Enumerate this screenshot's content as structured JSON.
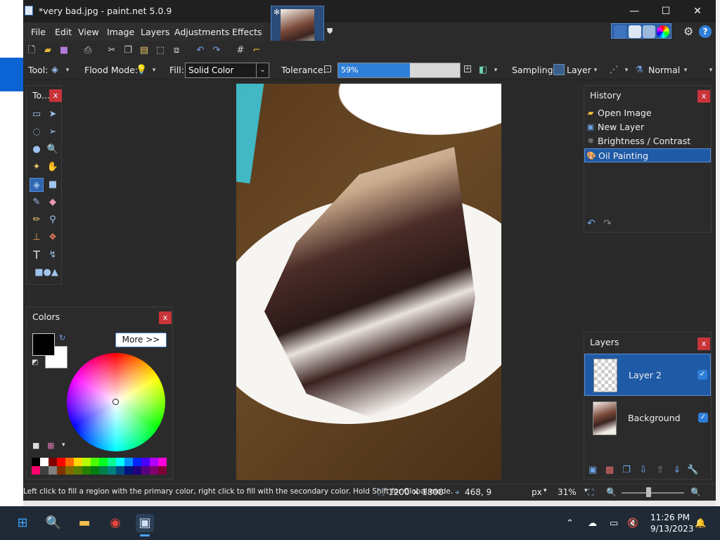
{
  "window": {
    "title": "*very bad.jpg - paint.net 5.0.9",
    "controls": {
      "minimize": "—",
      "maximize": "☐",
      "close": "✕"
    }
  },
  "menu": [
    "File",
    "Edit",
    "View",
    "Image",
    "Layers",
    "Adjustments",
    "Effects"
  ],
  "options": {
    "tool_label": "Tool:",
    "flood_mode_label": "Flood Mode:",
    "fill_label": "Fill:",
    "fill_value": "Solid Color",
    "tolerance_label": "Tolerance:",
    "tolerance_value": "59%",
    "tolerance_fraction": 0.59,
    "sampling_label": "Sampling:",
    "sampling_value": "Layer",
    "blend_value": "Normal"
  },
  "tools_panel": {
    "title": "To...",
    "close": "x"
  },
  "colors_panel": {
    "title": "Colors",
    "close": "x",
    "more_button": "More >>"
  },
  "palette_colors": [
    "#000000",
    "#ffffff",
    "#7f0000",
    "#ff0000",
    "#ff6a00",
    "#ffd800",
    "#b6ff00",
    "#4cff00",
    "#00ff21",
    "#00ff90",
    "#00ffff",
    "#0094ff",
    "#0026ff",
    "#4800ff",
    "#b200ff",
    "#ff00dc",
    "#ff006e",
    "#404040",
    "#808080",
    "#7f3300",
    "#7f6a00",
    "#5b7f00",
    "#267f00",
    "#007f0e",
    "#007f46",
    "#007f7f",
    "#004a7f",
    "#00137f",
    "#21007f",
    "#57007f",
    "#7f006e",
    "#7f0037"
  ],
  "history_panel": {
    "title": "History",
    "close": "x",
    "items": [
      {
        "label": "Open Image",
        "icon": "folder-icon"
      },
      {
        "label": "New Layer",
        "icon": "new-layer-icon"
      },
      {
        "label": "Brightness / Contrast",
        "icon": "brightness-icon"
      },
      {
        "label": "Oil Painting",
        "icon": "oil-painting-icon"
      }
    ]
  },
  "layers_panel": {
    "title": "Layers",
    "close": "x",
    "items": [
      {
        "name": "Layer 2",
        "visible_mark": "✓"
      },
      {
        "name": "Background",
        "visible_mark": "✓"
      }
    ]
  },
  "status": {
    "hint": "Left click to fill a region with the primary color, right click to fill with the secondary color. Hold Shift for Global mode.",
    "image_size": "1200 × 1800",
    "cursor_pos": "468, 9",
    "units": "px",
    "zoom": "31%"
  },
  "taskbar": {
    "time": "11:26 PM",
    "date": "9/13/2023"
  }
}
